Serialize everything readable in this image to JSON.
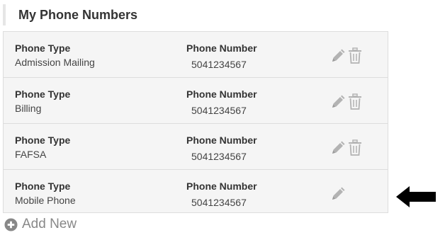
{
  "section": {
    "title": "My Phone Numbers"
  },
  "table": {
    "type_label": "Phone Type",
    "number_label": "Phone Number",
    "rows": [
      {
        "type": "Admission Mailing",
        "number": "5041234567",
        "deletable": true
      },
      {
        "type": "Billing",
        "number": "5041234567",
        "deletable": true
      },
      {
        "type": "FAFSA",
        "number": "5041234567",
        "deletable": true
      },
      {
        "type": "Mobile Phone",
        "number": "5041234567",
        "deletable": false
      }
    ]
  },
  "actions": {
    "add_new_label": "Add New",
    "add_icon": "plus-circle-icon"
  },
  "icons": {
    "edit": "pencil-icon",
    "delete": "trash-icon",
    "pointer": "arrow-left-icon"
  },
  "colors": {
    "row_bg": "#f5f5f5",
    "border": "#dddddd",
    "icon": "#b3b3b3",
    "arrow": "#000000"
  }
}
